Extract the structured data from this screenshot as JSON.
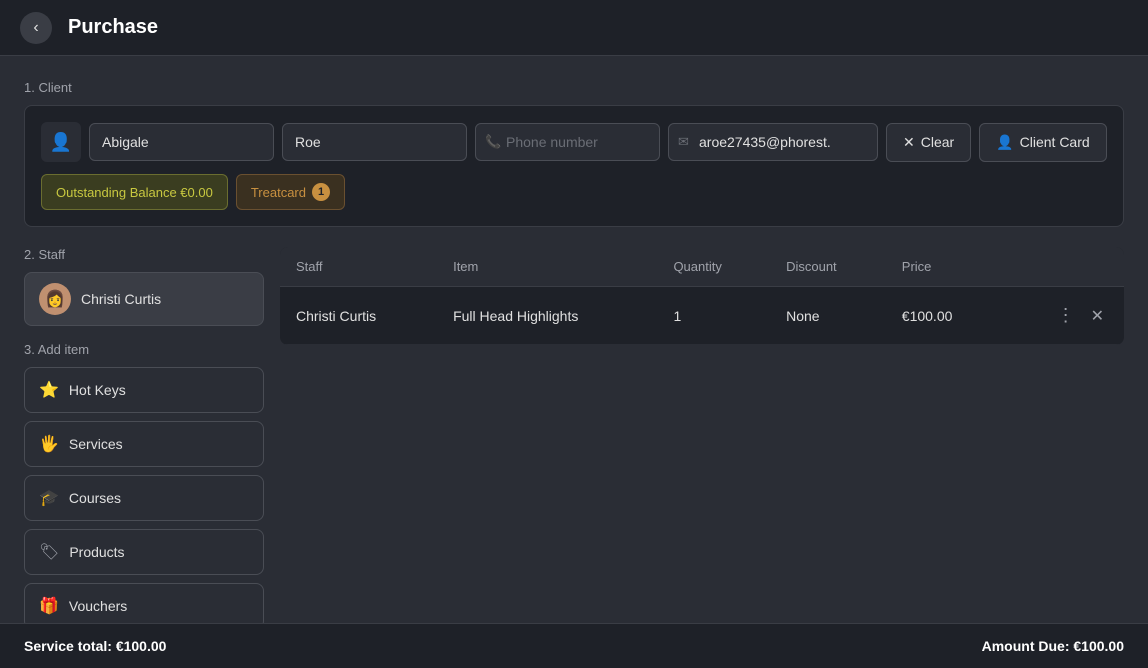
{
  "header": {
    "back_label": "‹",
    "title": "Purchase"
  },
  "sections": {
    "client_label": "1. Client",
    "staff_label": "2. Staff",
    "add_item_label": "3. Add item"
  },
  "client": {
    "first_name": "Abigale",
    "last_name": "Roe",
    "phone_placeholder": "Phone number",
    "email": "aroe27435@phorest.",
    "clear_label": "Clear",
    "client_card_label": "Client Card",
    "outstanding_balance_label": "Outstanding Balance €0.00",
    "treatcard_label": "Treatcard",
    "treatcard_count": "1"
  },
  "staff": {
    "name": "Christi Curtis"
  },
  "add_item_buttons": [
    {
      "id": "hot-keys",
      "label": "Hot Keys",
      "icon": "⭐"
    },
    {
      "id": "services",
      "label": "Services",
      "icon": "🖐"
    },
    {
      "id": "courses",
      "label": "Courses",
      "icon": "🎓"
    },
    {
      "id": "products",
      "label": "Products",
      "icon": "🏷"
    },
    {
      "id": "vouchers",
      "label": "Vouchers",
      "icon": "🎁"
    }
  ],
  "table": {
    "columns": [
      "Staff",
      "Item",
      "Quantity",
      "Discount",
      "Price",
      ""
    ],
    "rows": [
      {
        "staff": "Christi Curtis",
        "item": "Full Head Highlights",
        "quantity": "1",
        "discount": "None",
        "price": "€100.00"
      }
    ]
  },
  "footer": {
    "service_total_label": "Service total:",
    "service_total_value": "€100.00",
    "amount_due_label": "Amount Due:",
    "amount_due_value": "€100.00"
  }
}
